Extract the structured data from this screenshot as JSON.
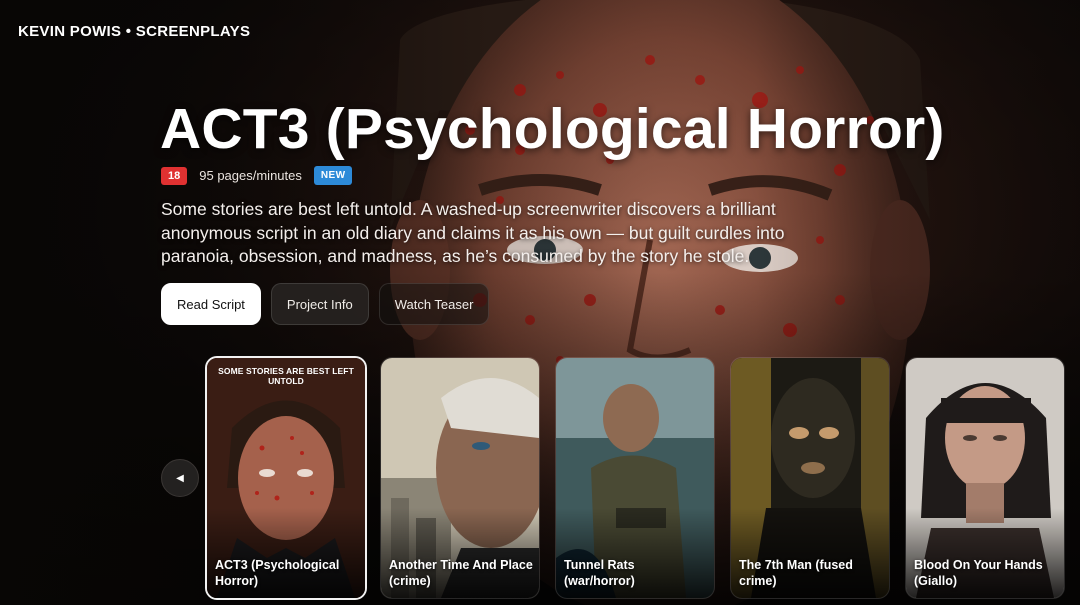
{
  "brand": "KEVIN POWIS • SCREENPLAYS",
  "hero": {
    "title": "ACT3 (Psychological Horror)",
    "age_rating": "18",
    "pages": "95 pages/minutes",
    "badge": "NEW",
    "description": "Some stories are best left untold. A washed-up screenwriter discovers a brilliant anonymous script in an old diary and claims it as his own — but guilt curdles into paranoia, obsession, and madness, as he’s consumed by the story he stole."
  },
  "buttons": {
    "read": "Read Script",
    "info": "Project Info",
    "teaser": "Watch Teaser"
  },
  "carousel": {
    "prev_icon": "play-left-icon",
    "cards": [
      {
        "title": "ACT3 (Psychological Horror)",
        "tagline": "SOME STORIES ARE BEST LEFT UNTOLD",
        "active": true
      },
      {
        "title": "Another Time And Place (crime)"
      },
      {
        "title": "Tunnel Rats (war/horror)"
      },
      {
        "title": "The 7th Man (fused crime)"
      },
      {
        "title": "Blood On Your Hands (Giallo)"
      }
    ]
  },
  "colors": {
    "age_badge": "#e03131",
    "new_badge": "#2d8ad8",
    "primary_button": "#ffffff"
  }
}
